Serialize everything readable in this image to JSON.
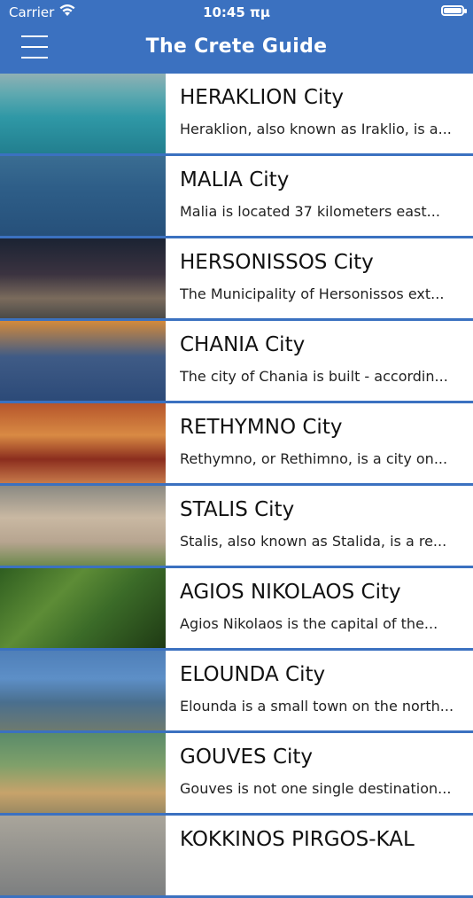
{
  "status_bar": {
    "carrier": "Carrier",
    "time": "10:45 πμ"
  },
  "header": {
    "title": "The Crete Guide"
  },
  "cities": [
    {
      "name": "HERAKLION City",
      "description": "Heraklion, also known as Iraklio, is a..."
    },
    {
      "name": "MALIA City",
      "description": "Malia is located 37 kilometers east..."
    },
    {
      "name": "HERSONISSOS City",
      "description": "The Municipality of Hersonissos ext..."
    },
    {
      "name": "CHANIA City",
      "description": "The city of Chania is built - accordin..."
    },
    {
      "name": "RETHYMNO City",
      "description": "Rethymno, or Rethimno, is a city on..."
    },
    {
      "name": "STALIS City",
      "description": "Stalis, also known as Stalida, is a re..."
    },
    {
      "name": "AGIOS NIKOLAOS City",
      "description": "Agios Nikolaos is the capital of the..."
    },
    {
      "name": "ELOUNDA City",
      "description": "Elounda is a small town on the north..."
    },
    {
      "name": "GOUVES City",
      "description": "Gouves is not one single destination..."
    },
    {
      "name": "KOKKINOS PIRGOS-KAL",
      "description": ""
    }
  ],
  "colors": {
    "accent": "#3b71c0"
  }
}
